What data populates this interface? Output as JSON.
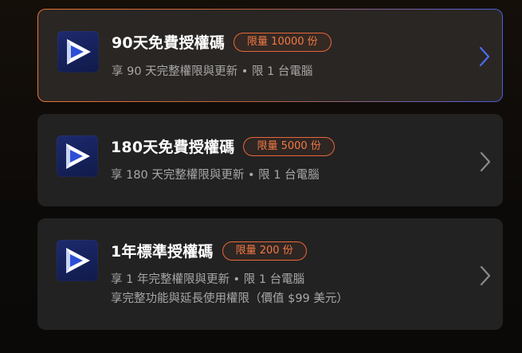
{
  "plans": [
    {
      "title": "90天免費授權碼",
      "badge": "限量 10000 份",
      "desc_lines": [
        "享 90 天完整權限與更新 • 限 1 台電腦"
      ],
      "selected": true,
      "icon": "app-play-logo-icon",
      "chevron": "chevron-right-icon"
    },
    {
      "title": "180天免費授權碼",
      "badge": "限量 5000 份",
      "desc_lines": [
        "享 180 天完整權限與更新 • 限 1 台電腦"
      ],
      "selected": false,
      "icon": "app-play-logo-icon",
      "chevron": "chevron-right-icon"
    },
    {
      "title": "1年標準授權碼",
      "badge": "限量 200 份",
      "desc_lines": [
        "享 1 年完整權限與更新 • 限 1 台電腦",
        "享完整功能與延長使用權限（價值 $99 美元）"
      ],
      "selected": false,
      "icon": "app-play-logo-icon",
      "chevron": "chevron-right-icon"
    }
  ],
  "colors": {
    "card_bg": "#222222",
    "selected_card_bg": "#2a2623",
    "badge_orange": "#f07a45",
    "selected_chevron": "#4b6cf0",
    "chevron": "#8a8a8a",
    "icon_bg": "#1d2a6e"
  }
}
